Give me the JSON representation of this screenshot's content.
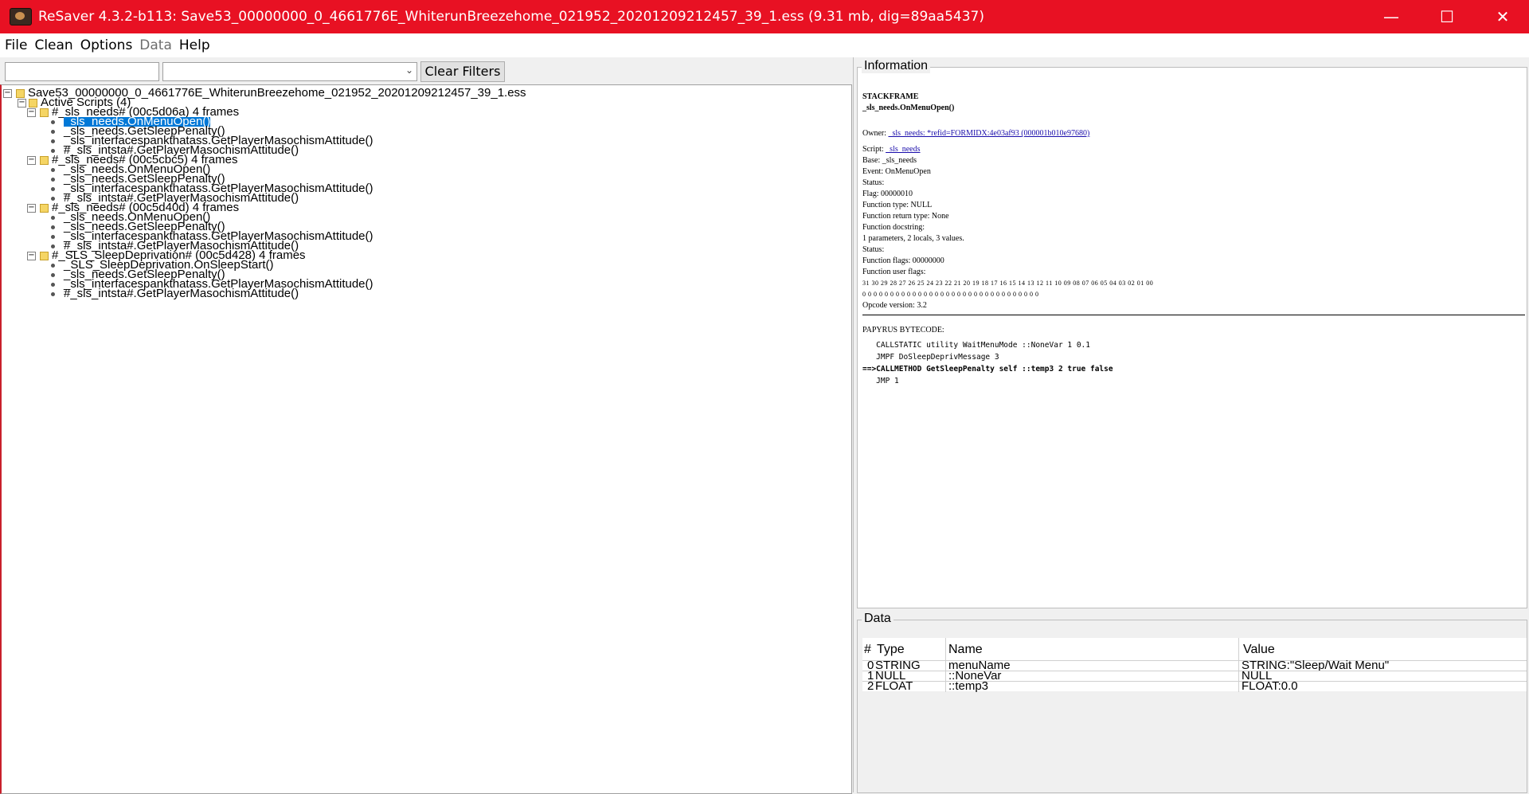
{
  "window": {
    "title": "ReSaver 4.3.2-b113: Save53_00000000_0_4661776E_WhiterunBreezehome_021952_20201209212457_39_1.ess (9.31 mb, dig=89aa5437)",
    "controls": {
      "minimize": "—",
      "maximize": "☐",
      "close": "✕"
    }
  },
  "menu": [
    "File",
    "Clean",
    "Options",
    "Data",
    "Help"
  ],
  "filter": {
    "text_value": "",
    "combo_value": "",
    "clear_label": "Clear Filters"
  },
  "tree": {
    "root": "Save53_00000000_0_4661776E_WhiterunBreezehome_021952_20201209212457_39_1.ess",
    "active_scripts": "Active Scripts (4)",
    "threads": [
      {
        "label": "#_sls_needs# (00c5d06a) 4 frames",
        "frames": [
          "_sls_needs.OnMenuOpen()",
          "_sls_needs.GetSleepPenalty()",
          "_sls_interfacespankthatass.GetPlayerMasochismAttitude()",
          "#_sls_intsta#.GetPlayerMasochismAttitude()"
        ]
      },
      {
        "label": "#_sls_needs# (00c5cbc5) 4 frames",
        "frames": [
          "_sls_needs.OnMenuOpen()",
          "_sls_needs.GetSleepPenalty()",
          "_sls_interfacespankthatass.GetPlayerMasochismAttitude()",
          "#_sls_intsta#.GetPlayerMasochismAttitude()"
        ]
      },
      {
        "label": "#_sls_needs# (00c5d40d) 4 frames",
        "frames": [
          "_sls_needs.OnMenuOpen()",
          "_sls_needs.GetSleepPenalty()",
          "_sls_interfacespankthatass.GetPlayerMasochismAttitude()",
          "#_sls_intsta#.GetPlayerMasochismAttitude()"
        ]
      },
      {
        "label": "#_SLS_SleepDeprivation# (00c5d428) 4 frames",
        "frames": [
          "_SLS_SleepDeprivation.OnSleepStart()",
          "_sls_needs.GetSleepPenalty()",
          "_sls_interfacespankthatass.GetPlayerMasochismAttitude()",
          "#_sls_intsta#.GetPlayerMasochismAttitude()"
        ]
      }
    ]
  },
  "info": {
    "panel_title": "Information",
    "heading": "STACKFRAME",
    "subheading": "_sls_needs.OnMenuOpen()",
    "owner_label": "Owner:",
    "owner_link": "_sls_needs: *refid=FORMIDX:4e03af93 (000001b010e97680)",
    "script_label": "Script:",
    "script_link": "_sls_needs",
    "lines": [
      "Base: _sls_needs",
      "Event: OnMenuOpen",
      "Status:",
      "Flag: 00000010",
      "Function type: NULL",
      "Function return type: None",
      "Function docstring:",
      "1 parameters, 2 locals, 3 values.",
      "Status:",
      "Function flags: 00000000",
      "Function user flags:"
    ],
    "bit_numbers": "31 30 29 28 27 26 25 24 23 22 21 20 19 18 17 16 15 14 13 12 11 10 09 08 07 06 05 04 03 02 01 00",
    "bit_values": "0  0  0  0  0  0  0  0  0  0  0  0  0  0  0  0  0  0  0  0  0  0  0  0  0  0  0  0  0  0  0  0",
    "opcode_version": "Opcode version: 3.2",
    "bytecode_title": "PAPYRUS BYTECODE:",
    "bytecode": [
      "   CALLSTATIC utility WaitMenuMode ::NoneVar 1 0.1",
      "   JMPF DoSleepDeprivMessage 3",
      "==>CALLMETHOD GetSleepPenalty self ::temp3 2 true false",
      "   JMP 1"
    ]
  },
  "data_panel": {
    "title": "Data",
    "columns": [
      "#",
      "Type",
      "Name",
      "Value"
    ],
    "rows": [
      [
        "0",
        "STRING",
        "menuName",
        "STRING:\"Sleep/Wait Menu\""
      ],
      [
        "1",
        "NULL",
        "::NoneVar",
        "NULL"
      ],
      [
        "2",
        "FLOAT",
        "::temp3",
        "FLOAT:0.0"
      ]
    ]
  },
  "icons": [
    "app-icon",
    "minimize-icon",
    "maximize-icon",
    "close-icon",
    "folder-icon",
    "bullet-icon",
    "chevron-down-icon"
  ],
  "colors": {
    "titlebar": "#e81123",
    "selection": "#0078d7",
    "link": "#1a0dab"
  }
}
